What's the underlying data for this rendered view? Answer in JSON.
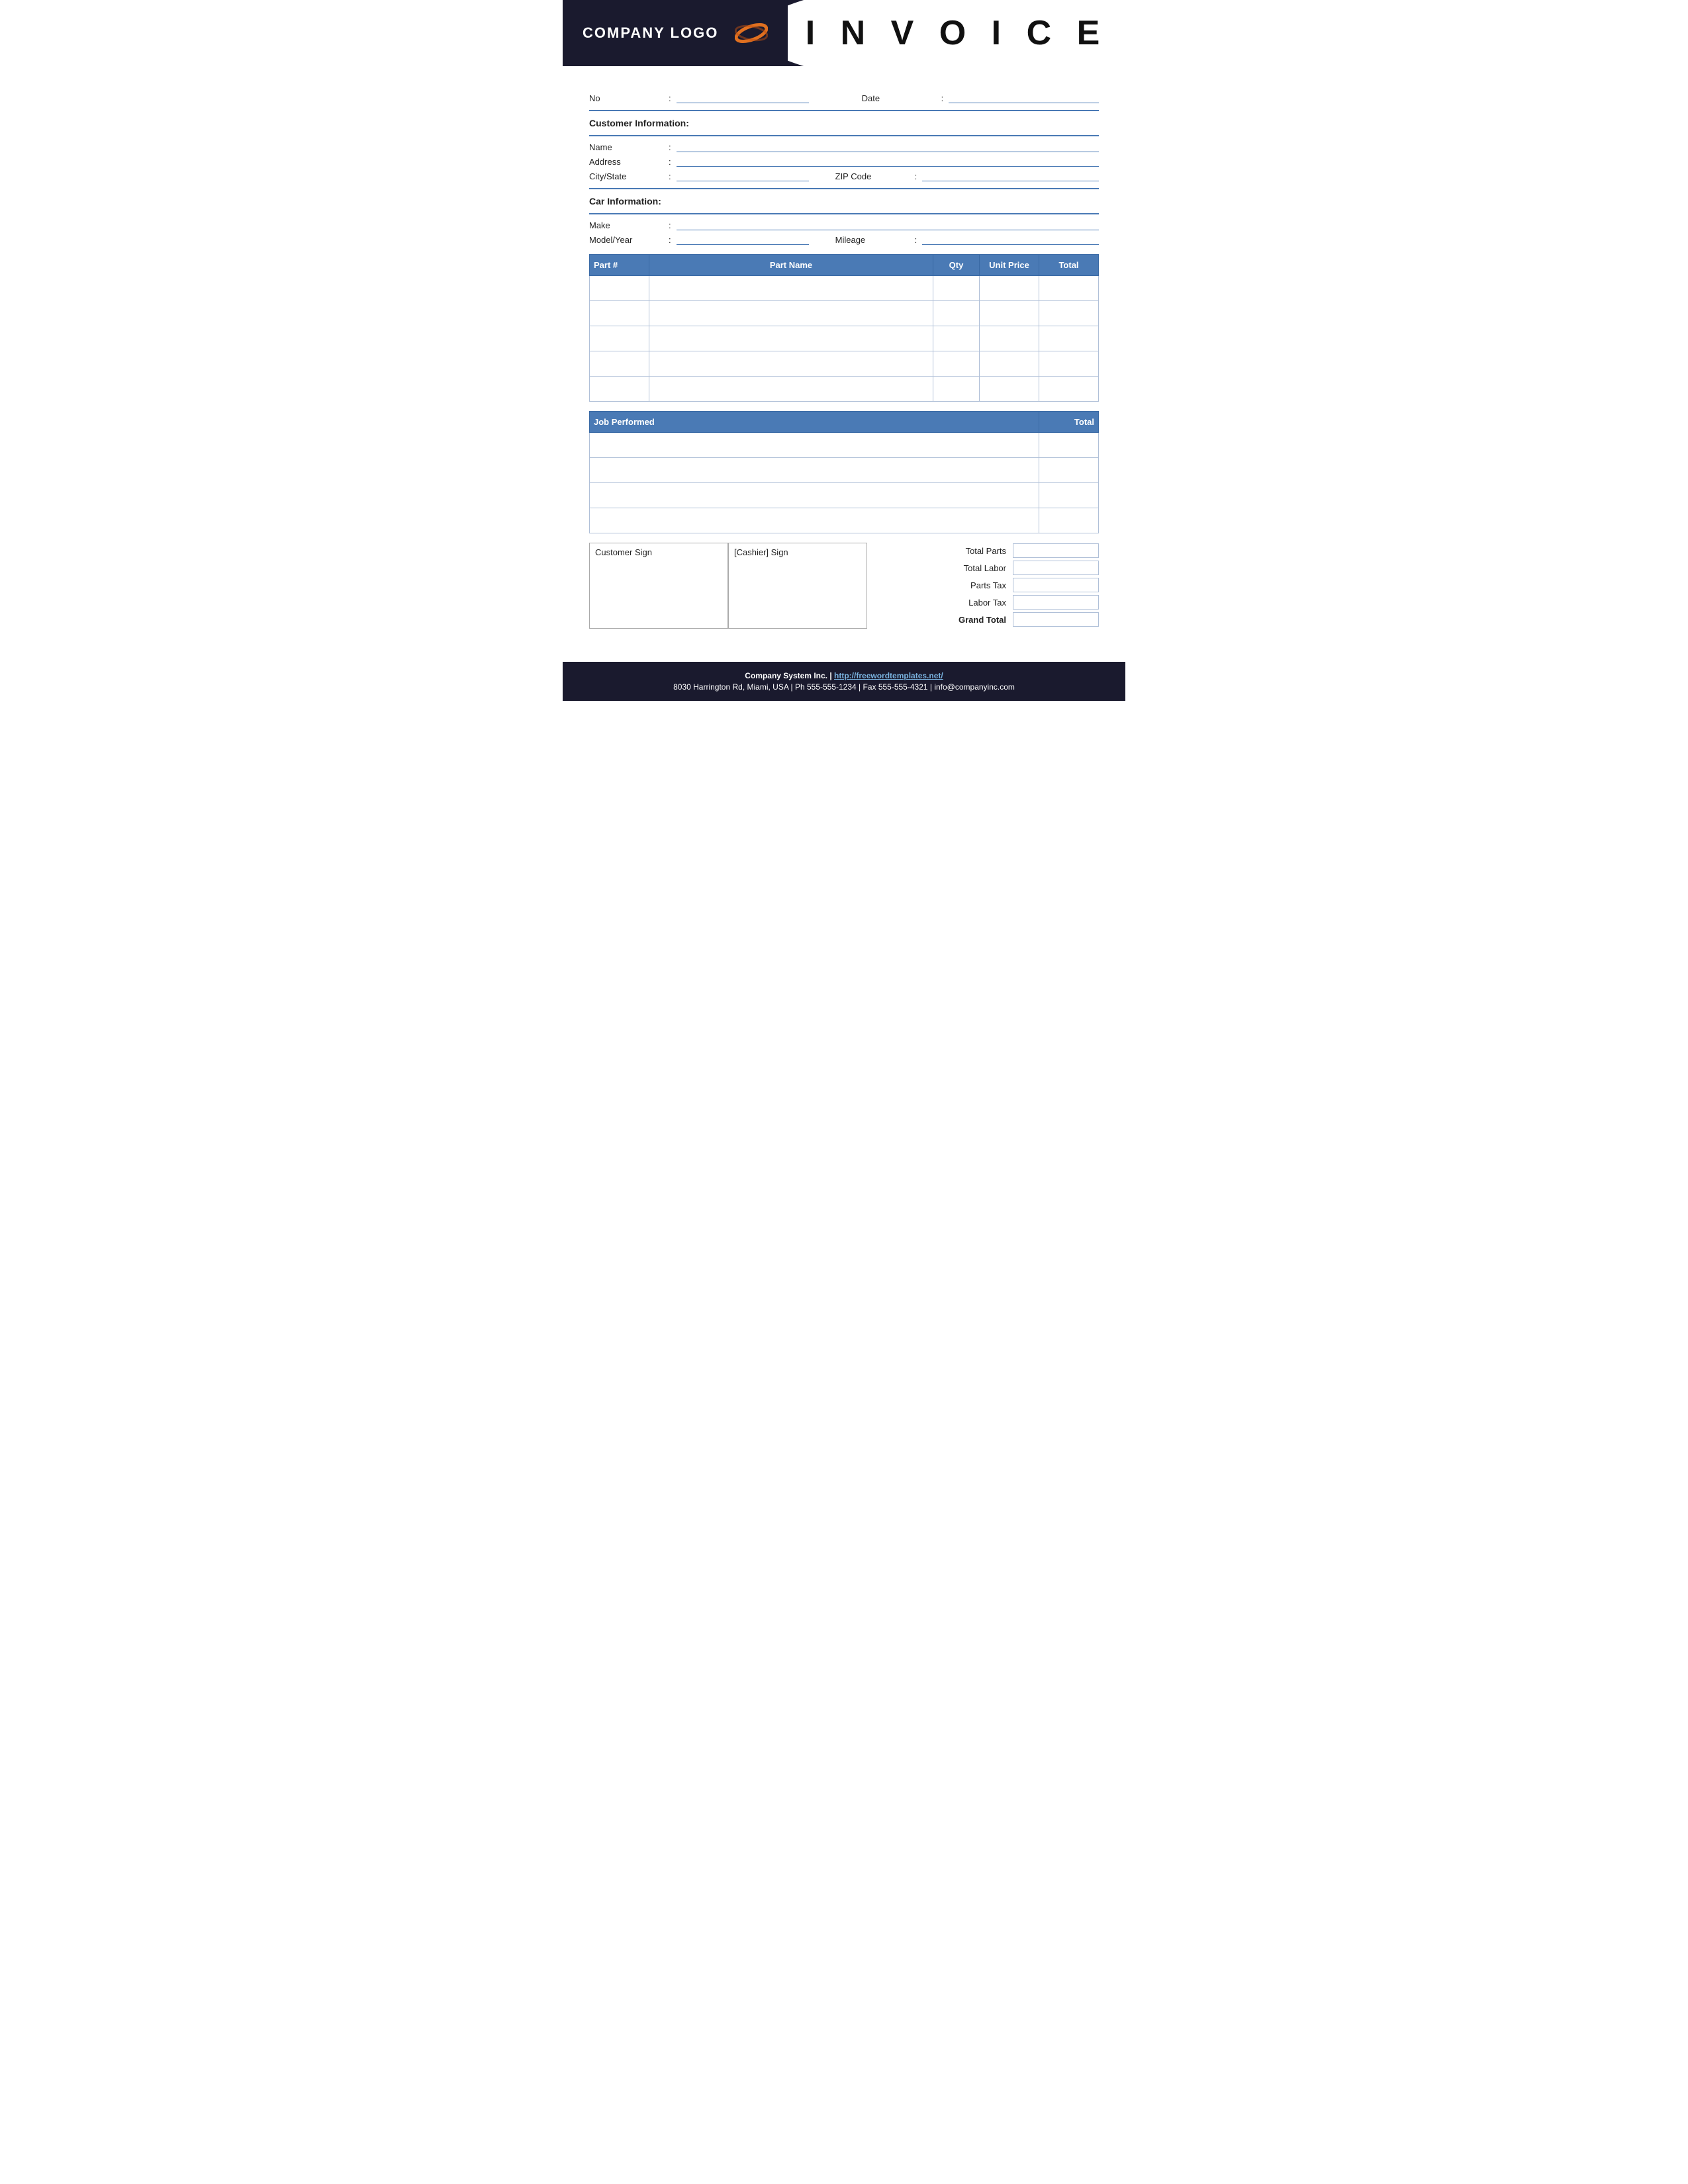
{
  "header": {
    "logo_text": "COMPANY LOGO",
    "title": "I N V O I C E"
  },
  "fields": {
    "no_label": "No",
    "date_label": "Date",
    "colon": ":"
  },
  "customer": {
    "section_title": "Customer Information:",
    "name_label": "Name",
    "address_label": "Address",
    "city_label": "City/State",
    "zip_label": "ZIP Code",
    "colon": ":"
  },
  "car": {
    "section_title": "Car Information:",
    "make_label": "Make",
    "model_label": "Model/Year",
    "mileage_label": "Mileage",
    "colon": ":"
  },
  "parts_table": {
    "col_part": "Part #",
    "col_name": "Part Name",
    "col_qty": "Qty",
    "col_price": "Unit Price",
    "col_total": "Total",
    "rows": 5
  },
  "job_table": {
    "col_job": "Job Performed",
    "col_total": "Total",
    "rows": 4
  },
  "signatures": {
    "customer_sign": "Customer Sign",
    "cashier_sign": "[Cashier] Sign"
  },
  "totals": {
    "total_parts": "Total Parts",
    "total_labor": "Total Labor",
    "parts_tax": "Parts Tax",
    "labor_tax": "Labor Tax",
    "grand_total": "Grand Total"
  },
  "footer": {
    "line1_company": "Company System Inc. |",
    "line1_url": "http://freewordtemplates.net/",
    "line2": "8030 Harrington Rd, Miami, USA | Ph 555-555-1234 | Fax 555-555-4321 | info@companyinc.com"
  }
}
